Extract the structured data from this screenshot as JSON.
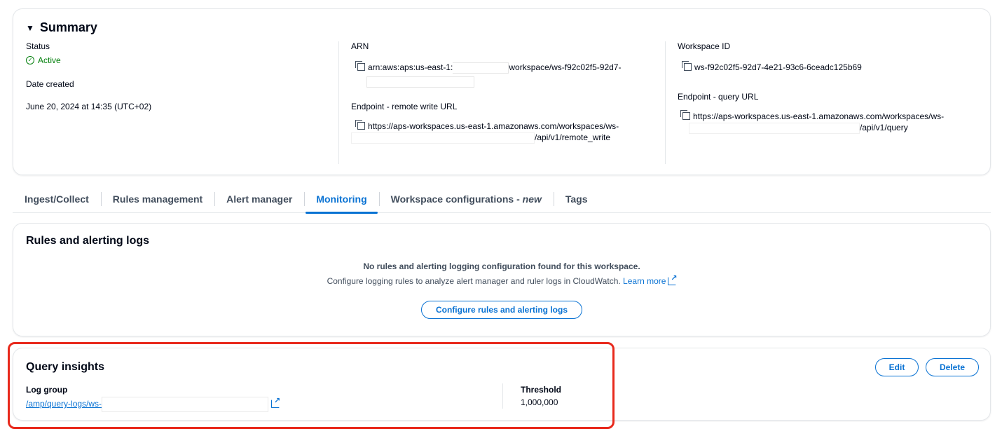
{
  "summary": {
    "title": "Summary",
    "status_label": "Status",
    "status_value": "Active",
    "date_label": "Date created",
    "date_value": "June 20, 2024 at 14:35 (UTC+02)",
    "arn_label": "ARN",
    "arn_prefix": "arn:aws:aps:us-east-1:",
    "arn_suffix": "workspace/ws-f92c02f5-92d7-",
    "remote_write_label": "Endpoint - remote write URL",
    "remote_write_line1": "https://aps-workspaces.us-east-1.amazonaws.com/workspaces/ws-",
    "remote_write_line2": "/api/v1/remote_write",
    "workspace_id_label": "Workspace ID",
    "workspace_id_value": "ws-f92c02f5-92d7-4e21-93c6-6ceadc125b69",
    "query_url_label": "Endpoint - query URL",
    "query_url_line1": "https://aps-workspaces.us-east-1.amazonaws.com/workspaces/ws-",
    "query_url_line2": "/api/v1/query"
  },
  "tabs": [
    {
      "label": "Ingest/Collect"
    },
    {
      "label": "Rules management"
    },
    {
      "label": "Alert manager"
    },
    {
      "label": "Monitoring"
    },
    {
      "label": "Workspace configurations - ",
      "label_em": "new"
    },
    {
      "label": "Tags"
    }
  ],
  "active_tab": "Monitoring",
  "rules_panel": {
    "title": "Rules and alerting logs",
    "empty_title": "No rules and alerting logging configuration found for this workspace.",
    "empty_desc": "Configure logging rules to analyze alert manager and ruler logs in CloudWatch.",
    "learn_more": "Learn more",
    "configure_button": "Configure rules and alerting logs"
  },
  "insights_panel": {
    "title": "Query insights",
    "log_group_label": "Log group",
    "log_group_value": "/amp/query-logs/ws-",
    "threshold_label": "Threshold",
    "threshold_value": "1,000,000",
    "edit_button": "Edit",
    "delete_button": "Delete"
  },
  "colors": {
    "accent": "#0972d3",
    "success": "#037f0c",
    "highlight": "#e8291c"
  },
  "icons": [
    "caret-down-icon",
    "status-ok-icon",
    "copy-icon",
    "external-link-icon"
  ]
}
